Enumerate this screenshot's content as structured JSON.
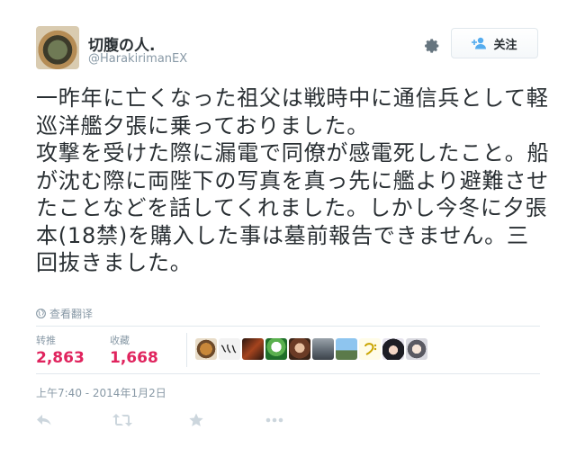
{
  "user": {
    "display_name": "切腹の人.",
    "screen_name": "@HarakirimanEX"
  },
  "follow_button": {
    "label": "关注"
  },
  "tweet": {
    "text": "一昨年に亡くなった祖父は戦時中に通信兵として軽巡洋艦夕張に乗っておりました。\n攻撃を受けた際に漏電で同僚が感電死したこと。船が沈む際に両陛下の写真を真っ先に艦より避難させたことなどを話してくれました。しかし今冬に夕張本(18禁)を購入した事は墓前報告できません。三回抜きました。"
  },
  "translate_link": "查看翻译",
  "stats": {
    "retweets_label": "转推",
    "retweets_value": "2,863",
    "favorites_label": "收藏",
    "favorites_value": "1,668"
  },
  "timestamp": "上午7:40 - 2014年1月2日",
  "colors": {
    "count": "#e0245e",
    "muted": "#8899a6",
    "divider": "#e1e8ed"
  },
  "icons": {
    "settings": "gear-icon",
    "follow": "add-user-icon",
    "translate": "globe-icon",
    "reply": "reply-icon",
    "retweet": "retweet-icon",
    "favorite": "star-icon",
    "more": "more-icon"
  }
}
